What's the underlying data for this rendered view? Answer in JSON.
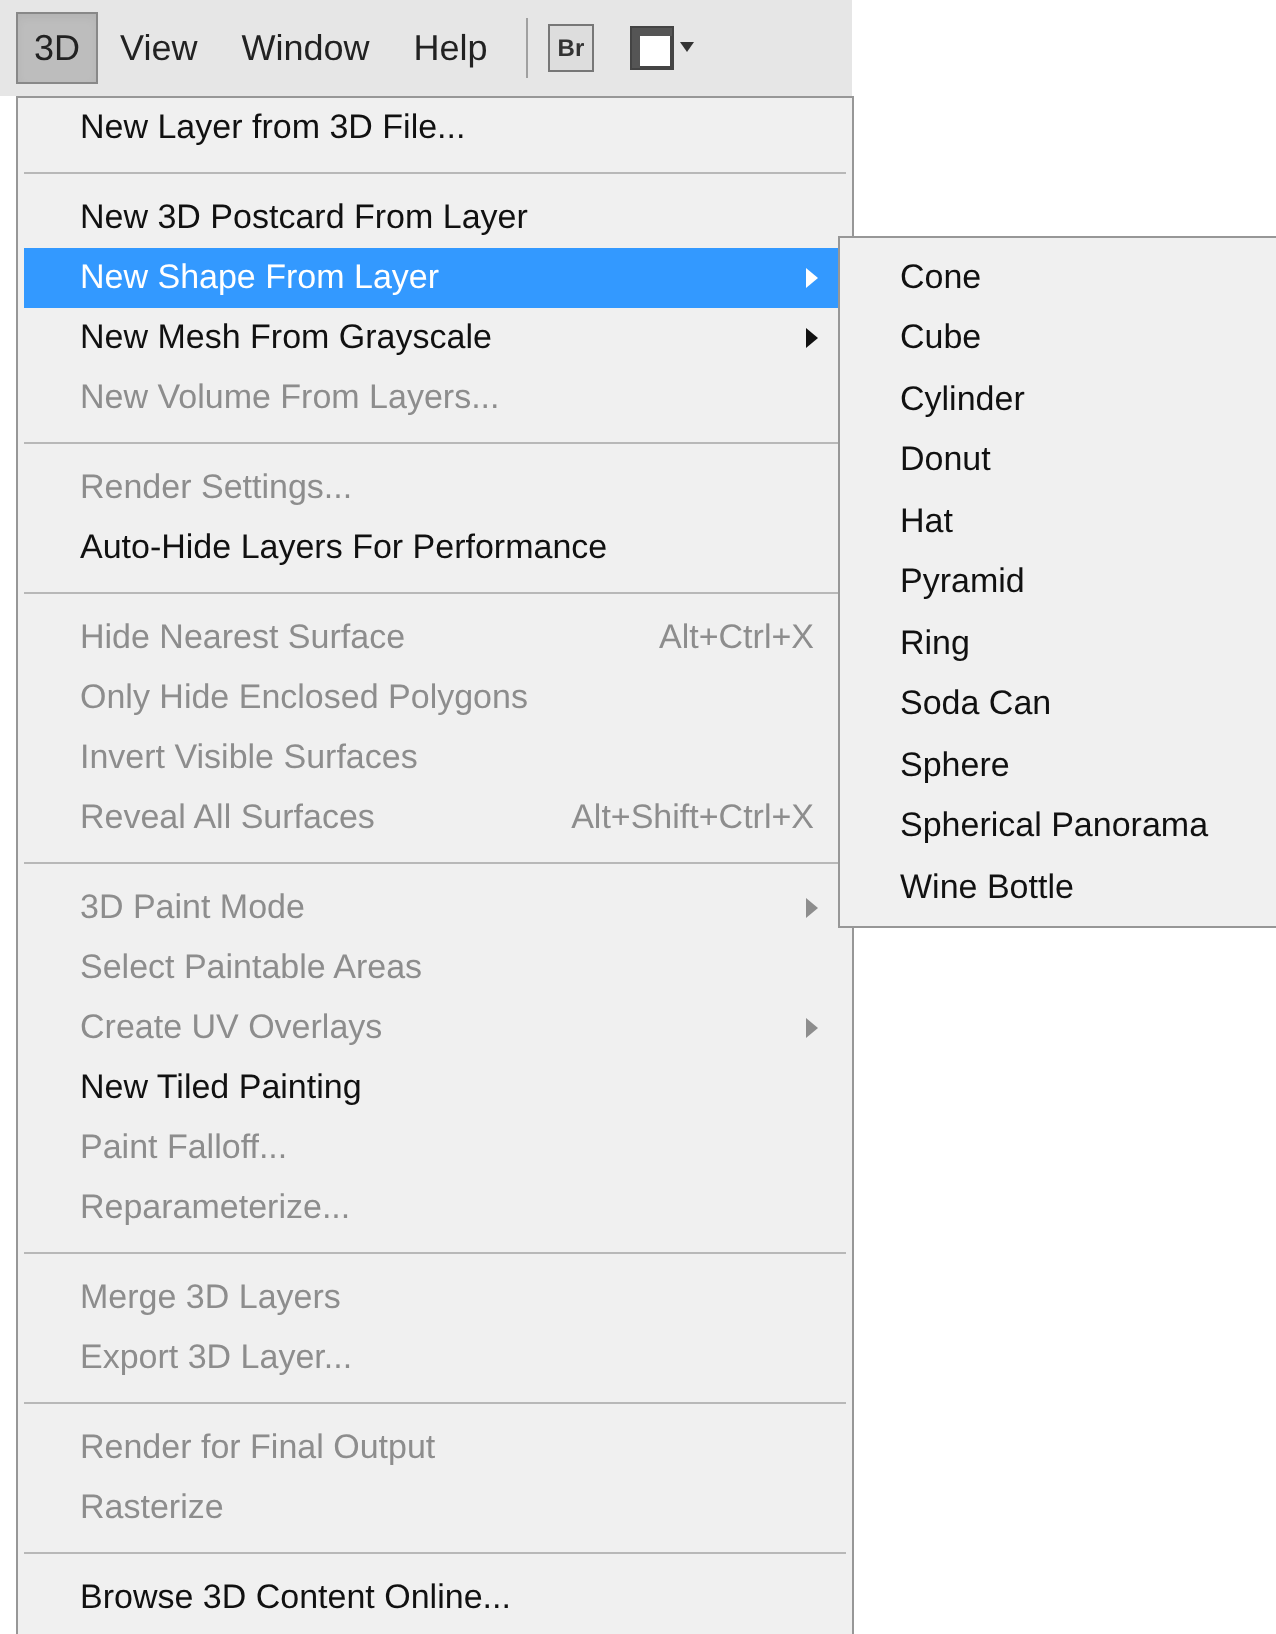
{
  "menu_bar": {
    "items": [
      {
        "label": "3D",
        "selected": true
      },
      {
        "label": "View",
        "selected": false
      },
      {
        "label": "Window",
        "selected": false
      },
      {
        "label": "Help",
        "selected": false
      }
    ],
    "bridge_button": "Br"
  },
  "menu": {
    "items": [
      {
        "kind": "item",
        "label": "New Layer from 3D File...",
        "disabled": false,
        "selected": false,
        "submenu": false
      },
      {
        "kind": "separator"
      },
      {
        "kind": "item",
        "label": "New 3D Postcard From Layer",
        "disabled": false,
        "selected": false,
        "submenu": false
      },
      {
        "kind": "item",
        "label": "New Shape From Layer",
        "disabled": false,
        "selected": true,
        "submenu": true
      },
      {
        "kind": "item",
        "label": "New Mesh From Grayscale",
        "disabled": false,
        "selected": false,
        "submenu": true
      },
      {
        "kind": "item",
        "label": "New Volume From Layers...",
        "disabled": true,
        "selected": false,
        "submenu": false
      },
      {
        "kind": "separator"
      },
      {
        "kind": "item",
        "label": "Render Settings...",
        "disabled": true,
        "selected": false,
        "submenu": false
      },
      {
        "kind": "item",
        "label": "Auto-Hide Layers For Performance",
        "disabled": false,
        "selected": false,
        "submenu": false
      },
      {
        "kind": "separator"
      },
      {
        "kind": "item",
        "label": "Hide Nearest Surface",
        "shortcut": "Alt+Ctrl+X",
        "disabled": true,
        "selected": false,
        "submenu": false
      },
      {
        "kind": "item",
        "label": "Only Hide Enclosed Polygons",
        "disabled": true,
        "selected": false,
        "submenu": false
      },
      {
        "kind": "item",
        "label": "Invert Visible Surfaces",
        "disabled": true,
        "selected": false,
        "submenu": false
      },
      {
        "kind": "item",
        "label": "Reveal All Surfaces",
        "shortcut": "Alt+Shift+Ctrl+X",
        "disabled": true,
        "selected": false,
        "submenu": false
      },
      {
        "kind": "separator"
      },
      {
        "kind": "item",
        "label": "3D Paint Mode",
        "disabled": true,
        "selected": false,
        "submenu": true
      },
      {
        "kind": "item",
        "label": "Select Paintable Areas",
        "disabled": true,
        "selected": false,
        "submenu": false
      },
      {
        "kind": "item",
        "label": "Create UV Overlays",
        "disabled": true,
        "selected": false,
        "submenu": true
      },
      {
        "kind": "item",
        "label": "New Tiled Painting",
        "disabled": false,
        "selected": false,
        "submenu": false
      },
      {
        "kind": "item",
        "label": "Paint Falloff...",
        "disabled": true,
        "selected": false,
        "submenu": false
      },
      {
        "kind": "item",
        "label": "Reparameterize...",
        "disabled": true,
        "selected": false,
        "submenu": false
      },
      {
        "kind": "separator"
      },
      {
        "kind": "item",
        "label": "Merge 3D Layers",
        "disabled": true,
        "selected": false,
        "submenu": false
      },
      {
        "kind": "item",
        "label": "Export 3D Layer...",
        "disabled": true,
        "selected": false,
        "submenu": false
      },
      {
        "kind": "separator"
      },
      {
        "kind": "item",
        "label": "Render for Final Output",
        "disabled": true,
        "selected": false,
        "submenu": false
      },
      {
        "kind": "item",
        "label": "Rasterize",
        "disabled": true,
        "selected": false,
        "submenu": false
      },
      {
        "kind": "separator"
      },
      {
        "kind": "item",
        "label": "Browse 3D Content Online...",
        "disabled": false,
        "selected": false,
        "submenu": false
      }
    ]
  },
  "submenu": {
    "items": [
      "Cone",
      "Cube",
      "Cylinder",
      "Donut",
      "Hat",
      "Pyramid",
      "Ring",
      "Soda Can",
      "Sphere",
      "Spherical Panorama",
      "Wine Bottle"
    ]
  }
}
